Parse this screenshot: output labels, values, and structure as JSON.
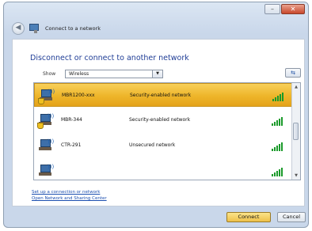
{
  "window": {
    "title": "Connect to a network",
    "min_label": "–",
    "close_label": "✕"
  },
  "nav": {
    "back_icon": "◀"
  },
  "main": {
    "heading": "Disconnect or connect to another network",
    "show_label": "Show",
    "show_value": "Wireless",
    "refresh_icon": "⇆"
  },
  "networks": [
    {
      "ssid": "MBR1200-xxx",
      "security": "Security-enabled network",
      "selected": true,
      "signal": 5
    },
    {
      "ssid": "MBR-344",
      "security": "Security-enabled network",
      "selected": false,
      "signal": 5
    },
    {
      "ssid": "CTR-291",
      "security": "Unsecured network",
      "selected": false,
      "signal": 5
    },
    {
      "ssid": "",
      "security": "",
      "selected": false,
      "signal": 5
    }
  ],
  "links": {
    "setup": "Set up a connection or network",
    "sharing": "Open Network and Sharing Center"
  },
  "buttons": {
    "connect": "Connect",
    "cancel": "Cancel"
  },
  "colors": {
    "accent": "#1f3d96",
    "selection": "#eeb52a",
    "signal": "#1a9a2a"
  }
}
